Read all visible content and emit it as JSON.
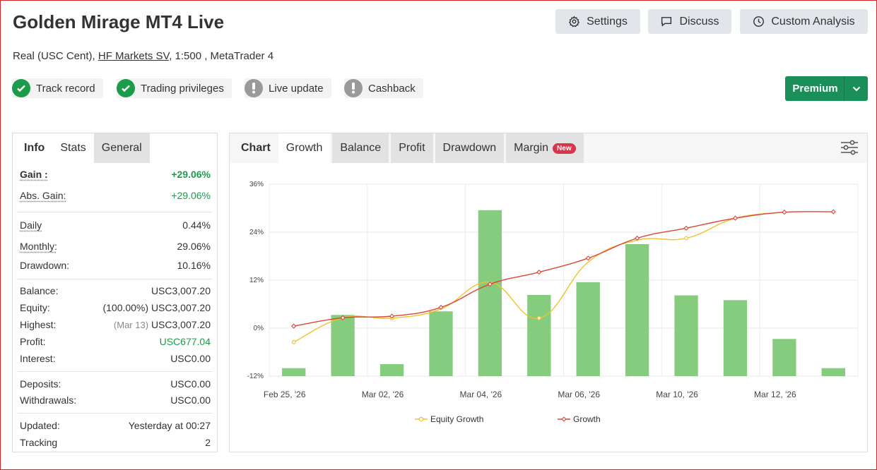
{
  "header": {
    "title": "Golden Mirage MT4 Live",
    "subtitle_prefix": "Real (USC Cent), ",
    "broker_link": "HF Markets SV",
    "subtitle_suffix": ", 1:500 , MetaTrader 4",
    "buttons": {
      "settings": "Settings",
      "discuss": "Discuss",
      "custom_analysis": "Custom Analysis"
    },
    "badges": [
      {
        "label": "Track record",
        "status": "ok",
        "icon": "check-circle-icon"
      },
      {
        "label": "Trading privileges",
        "status": "ok",
        "icon": "check-circle-icon"
      },
      {
        "label": "Live update",
        "status": "warning",
        "icon": "exclamation-circle-icon"
      },
      {
        "label": "Cashback",
        "status": "warning",
        "icon": "exclamation-circle-icon"
      }
    ],
    "premium_label": "Premium"
  },
  "colors": {
    "accent_green": "#1b8f5a",
    "positive": "#1c9c4a",
    "bar": "#86cc7e",
    "equity_line": "#f2c12e",
    "growth_line": "#d9473a",
    "new_badge": "#d8344a"
  },
  "left_panel": {
    "tabs": [
      "Info",
      "Stats",
      "General"
    ],
    "gain": {
      "label": "Gain :",
      "value": "+29.06%"
    },
    "abs_gain": {
      "label": "Abs. Gain:",
      "value": "+29.06%"
    },
    "daily": {
      "label": "Daily",
      "value": "0.44%"
    },
    "monthly": {
      "label": "Monthly:",
      "value": "29.06%"
    },
    "drawdown": {
      "label": "Drawdown:",
      "value": "10.16%"
    },
    "balance": {
      "label": "Balance:",
      "value": "USC3,007.20"
    },
    "equity": {
      "label": "Equity:",
      "note": "(100.00%)",
      "value": "USC3,007.20"
    },
    "highest": {
      "label": "Highest:",
      "note": "(Mar 13)",
      "value": "USC3,007.20"
    },
    "profit": {
      "label": "Profit:",
      "value": "USC677.04"
    },
    "interest": {
      "label": "Interest:",
      "value": "USC0.00"
    },
    "deposits": {
      "label": "Deposits:",
      "value": "USC0.00"
    },
    "withdrawals": {
      "label": "Withdrawals:",
      "value": "USC0.00"
    },
    "updated": {
      "label": "Updated:",
      "value": "Yesterday at 00:27"
    },
    "tracking": {
      "label": "Tracking",
      "value": "2"
    }
  },
  "right_panel": {
    "tabs": [
      "Chart",
      "Growth",
      "Balance",
      "Profit",
      "Drawdown",
      "Margin"
    ],
    "new_badge": "New"
  },
  "chart_data": {
    "type": "bar",
    "y_ticks": [
      "36%",
      "24%",
      "12%",
      "0%",
      "-12%"
    ],
    "ylim": [
      -12,
      36
    ],
    "x_ticks": [
      {
        "index": 0,
        "label": "Feb 25, '26"
      },
      {
        "index": 2,
        "label": "Mar 02, '26"
      },
      {
        "index": 4,
        "label": "Mar 04, '26"
      },
      {
        "index": 6,
        "label": "Mar 06, '26"
      },
      {
        "index": 8,
        "label": "Mar 10, '26"
      },
      {
        "index": 10,
        "label": "Mar 12, '26"
      }
    ],
    "bars": [
      -10,
      3.3,
      -9,
      4.2,
      29.5,
      8.3,
      11.5,
      21,
      8.2,
      7,
      -2.7,
      -10
    ],
    "series": [
      {
        "name": "Equity Growth",
        "values": [
          -3.5,
          2.6,
          2.5,
          4.8,
          11.5,
          2.5,
          16.5,
          22,
          22.5,
          27.5,
          29,
          29.1
        ]
      },
      {
        "name": "Growth",
        "values": [
          0.5,
          2.6,
          3,
          5.2,
          11,
          14,
          17.5,
          22.5,
          25,
          27.5,
          29,
          29.1
        ]
      }
    ],
    "grid": true,
    "legend_position": "bottom"
  }
}
